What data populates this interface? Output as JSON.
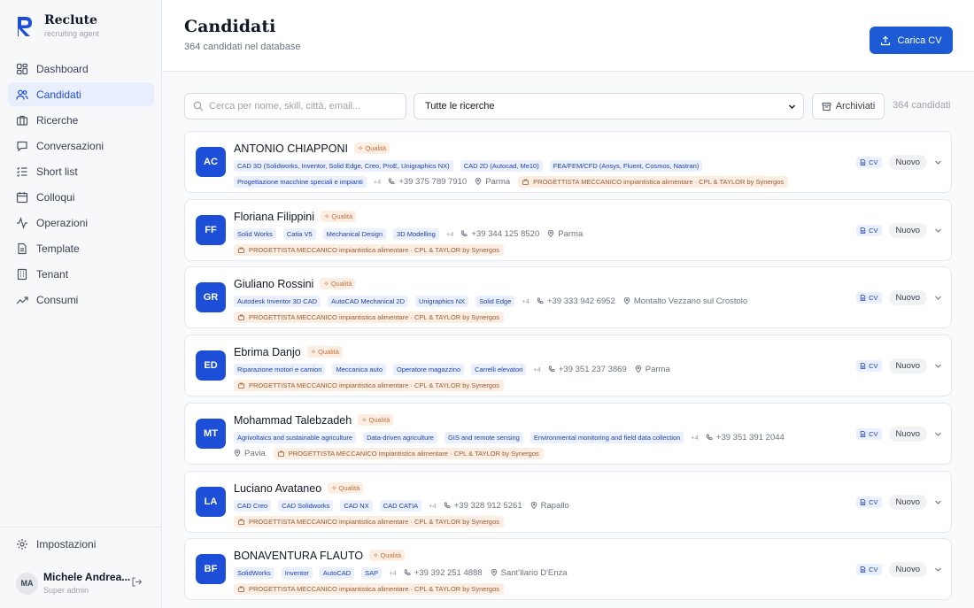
{
  "brand": {
    "name": "Reclute",
    "subtitle": "recruiting agent"
  },
  "nav": [
    {
      "label": "Dashboard",
      "icon": "dashboard-icon",
      "active": false
    },
    {
      "label": "Candidati",
      "icon": "users-icon",
      "active": true
    },
    {
      "label": "Ricerche",
      "icon": "briefcase-icon",
      "active": false
    },
    {
      "label": "Conversazioni",
      "icon": "chat-icon",
      "active": false
    },
    {
      "label": "Short list",
      "icon": "checklist-icon",
      "active": false
    },
    {
      "label": "Colloqui",
      "icon": "calendar-icon",
      "active": false
    },
    {
      "label": "Operazioni",
      "icon": "activity-icon",
      "active": false
    },
    {
      "label": "Template",
      "icon": "document-icon",
      "active": false
    },
    {
      "label": "Tenant",
      "icon": "building-icon",
      "active": false
    },
    {
      "label": "Consumi",
      "icon": "trend-icon",
      "active": false
    }
  ],
  "settings": {
    "label": "Impostazioni"
  },
  "user": {
    "initials": "MA",
    "name": "Michele Andrea...",
    "role": "Super admin"
  },
  "header": {
    "title": "Candidati",
    "subtitle": "364 candidati nel database",
    "upload_label": "Carica CV"
  },
  "filters": {
    "search_placeholder": "Cerca per nome, skill, città, email...",
    "select_value": "Tutte le ricerche",
    "archive_label": "Archiviati",
    "count": "364 candidati"
  },
  "colors": {
    "primary": "#1d5bd6",
    "avatar": "#1d4ed8",
    "tag_bg": "#eaf0fd",
    "tag_text": "#1e40af",
    "badge_bg": "#fdeee3",
    "badge_text": "#c2703a"
  },
  "quality_badge": "✧ Qualità",
  "cv_label": "CV",
  "candidates": [
    {
      "initials": "AC",
      "name": "ANTONIO CHIAPPONI",
      "status": "Nuovo",
      "line1": {
        "tags": [
          "CAD 3D (Solidworks, Inventor, Solid Edge, Creo, ProE, Unigraphics NX)",
          "CAD 2D (Autocad, Me10)",
          "FEA/FEM/CFD (Ansys, Fluent, Cosmos, Nastran)"
        ],
        "more": "",
        "phone": "",
        "city": "",
        "ricerca": ""
      },
      "line2": {
        "tags": [
          "Progettazione macchine speciali e impianti"
        ],
        "more": "+4",
        "phone": "+39 375 789 7910",
        "city": "Parma",
        "ricerca": "PROGETTISTA MECCANICO impiantistica alimentare · CPL & TAYLOR by Synergos"
      }
    },
    {
      "initials": "FF",
      "name": "Floriana Filippini",
      "status": "Nuovo",
      "line1": {
        "tags": [
          "Solid Works",
          "Catia V5",
          "Mechanical Design",
          "3D Modelling"
        ],
        "more": "+4",
        "phone": "+39 344 125 8520",
        "city": "Parma",
        "ricerca": ""
      },
      "line2": {
        "tags": [],
        "more": "",
        "phone": "",
        "city": "",
        "ricerca": "PROGETTISTA MECCANICO impiantistica alimentare · CPL & TAYLOR by Synergos"
      }
    },
    {
      "initials": "GR",
      "name": "Giuliano Rossini",
      "status": "Nuovo",
      "line1": {
        "tags": [
          "Autodesk Inventor 3D CAD",
          "AutoCAD Mechanical 2D",
          "Unigraphics NX",
          "Solid Edge"
        ],
        "more": "+4",
        "phone": "+39 333 942 6952",
        "city": "Montalto Vezzano sul Crostolo",
        "ricerca": ""
      },
      "line2": {
        "tags": [],
        "more": "",
        "phone": "",
        "city": "",
        "ricerca": "PROGETTISTA MECCANICO impiantistica alimentare · CPL & TAYLOR by Synergos"
      }
    },
    {
      "initials": "ED",
      "name": "Ebrima Danjo",
      "status": "Nuovo",
      "line1": {
        "tags": [
          "Riparazione motori e camion",
          "Meccanica auto",
          "Operatore magazzino",
          "Carrelli elevatori"
        ],
        "more": "+4",
        "phone": "+39 351 237 3869",
        "city": "Parma",
        "ricerca": ""
      },
      "line2": {
        "tags": [],
        "more": "",
        "phone": "",
        "city": "",
        "ricerca": "PROGETTISTA MECCANICO impiantistica alimentare · CPL & TAYLOR by Synergos"
      }
    },
    {
      "initials": "MT",
      "name": "Mohammad Talebzadeh",
      "status": "Nuovo",
      "line1": {
        "tags": [
          "Agrivoltaics and sustainable agriculture",
          "Data-driven agriculture",
          "GIS and remote sensing",
          "Environmental monitoring and field data collection"
        ],
        "more": "+4",
        "phone": "+39 351 391 2044",
        "city": "",
        "ricerca": ""
      },
      "line2": {
        "tags": [],
        "more": "",
        "phone": "",
        "city": "Pavia",
        "ricerca": "PROGETTISTA MECCANICO impiantistica alimentare · CPL & TAYLOR by Synergos"
      }
    },
    {
      "initials": "LA",
      "name": "Luciano Avataneo",
      "status": "Nuovo",
      "line1": {
        "tags": [
          "CAD Creo",
          "CAD Solidworks",
          "CAD NX",
          "CAD CATIA"
        ],
        "more": "+4",
        "phone": "+39 328 912 5261",
        "city": "Rapallo",
        "ricerca": ""
      },
      "line2": {
        "tags": [],
        "more": "",
        "phone": "",
        "city": "",
        "ricerca": "PROGETTISTA MECCANICO impiantistica alimentare · CPL & TAYLOR by Synergos"
      }
    },
    {
      "initials": "BF",
      "name": "BONAVENTURA FLAUTO",
      "status": "Nuovo",
      "line1": {
        "tags": [
          "SolidWorks",
          "Inventor",
          "AutoCAD",
          "SAP"
        ],
        "more": "+4",
        "phone": "+39 392 251 4888",
        "city": "Sant'Ilario D'Enza",
        "ricerca": ""
      },
      "line2": {
        "tags": [],
        "more": "",
        "phone": "",
        "city": "",
        "ricerca": "PROGETTISTA MECCANICO impiantistica alimentare · CPL & TAYLOR by Synergos"
      }
    }
  ]
}
